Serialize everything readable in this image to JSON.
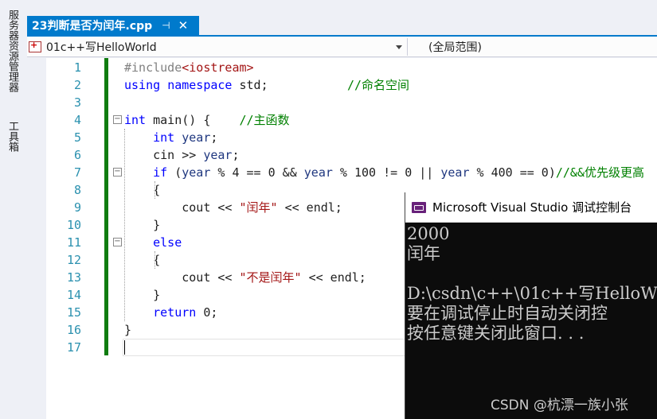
{
  "side_panels": [
    {
      "label": "服务器资源管理器"
    },
    {
      "label": "工具箱"
    }
  ],
  "document_tab": {
    "title": "23判断是否为闰年.cpp",
    "pin_glyph": "⊣",
    "close_glyph": "✕"
  },
  "nav_bar": {
    "project": "01c++写HelloWorld",
    "scope": "(全局范围)"
  },
  "code_lines": [
    {
      "n": "1",
      "parts": [
        [
          "pp",
          "#include"
        ],
        [
          "str",
          "<iostream>"
        ]
      ]
    },
    {
      "n": "2",
      "parts": [
        [
          "kw",
          "using"
        ],
        [
          "",
          " "
        ],
        [
          "kw",
          "namespace"
        ],
        [
          "",
          " std;           "
        ],
        [
          "cm",
          "//命名空间"
        ]
      ]
    },
    {
      "n": "3",
      "parts": []
    },
    {
      "n": "4",
      "parts": [
        [
          "kw",
          "int"
        ],
        [
          "",
          " main() {    "
        ],
        [
          "cm",
          "//主函数"
        ]
      ]
    },
    {
      "n": "5",
      "parts": [
        [
          "",
          "    "
        ],
        [
          "kw",
          "int"
        ],
        [
          "",
          " "
        ],
        [
          "id",
          "year"
        ],
        [
          "",
          ";"
        ]
      ]
    },
    {
      "n": "6",
      "parts": [
        [
          "",
          "    cin >> "
        ],
        [
          "id",
          "year"
        ],
        [
          "",
          ";"
        ]
      ]
    },
    {
      "n": "7",
      "parts": [
        [
          "",
          "    "
        ],
        [
          "kw",
          "if"
        ],
        [
          "",
          " ("
        ],
        [
          "id",
          "year"
        ],
        [
          "",
          " % 4 == 0 && "
        ],
        [
          "id",
          "year"
        ],
        [
          "",
          " % 100 != 0 || "
        ],
        [
          "id",
          "year"
        ],
        [
          "",
          " % 400 == 0)"
        ],
        [
          "cm",
          "//&&优先级更高"
        ]
      ]
    },
    {
      "n": "8",
      "parts": [
        [
          "",
          "    {"
        ]
      ]
    },
    {
      "n": "9",
      "parts": [
        [
          "",
          "        cout << "
        ],
        [
          "str",
          "\"闰年\""
        ],
        [
          "",
          " << endl;"
        ]
      ]
    },
    {
      "n": "10",
      "parts": [
        [
          "",
          "    }"
        ]
      ]
    },
    {
      "n": "11",
      "parts": [
        [
          "",
          "    "
        ],
        [
          "kw",
          "else"
        ]
      ]
    },
    {
      "n": "12",
      "parts": [
        [
          "",
          "    {"
        ]
      ]
    },
    {
      "n": "13",
      "parts": [
        [
          "",
          "        cout << "
        ],
        [
          "str",
          "\"不是闰年\""
        ],
        [
          "",
          " << endl;"
        ]
      ]
    },
    {
      "n": "14",
      "parts": [
        [
          "",
          "    }"
        ]
      ]
    },
    {
      "n": "15",
      "parts": [
        [
          "",
          "    "
        ],
        [
          "kw",
          "return"
        ],
        [
          "",
          " 0;"
        ]
      ]
    },
    {
      "n": "16",
      "parts": [
        [
          "",
          "}"
        ]
      ]
    },
    {
      "n": "17",
      "parts": []
    }
  ],
  "console": {
    "title": "Microsoft Visual Studio 调试控制台",
    "lines": [
      "2000",
      "闰年",
      "",
      "D:\\csdn\\c++\\01c++写HelloW",
      "要在调试停止时自动关闭控",
      "按任意键关闭此窗口. . ."
    ]
  },
  "watermark": "CSDN @杭漂一族小张",
  "colors": {
    "accent": "#007acc",
    "change_bar": "#107c10",
    "keyword": "#0000ff",
    "comment": "#008000",
    "string": "#a31515",
    "line_number": "#2b91af"
  }
}
